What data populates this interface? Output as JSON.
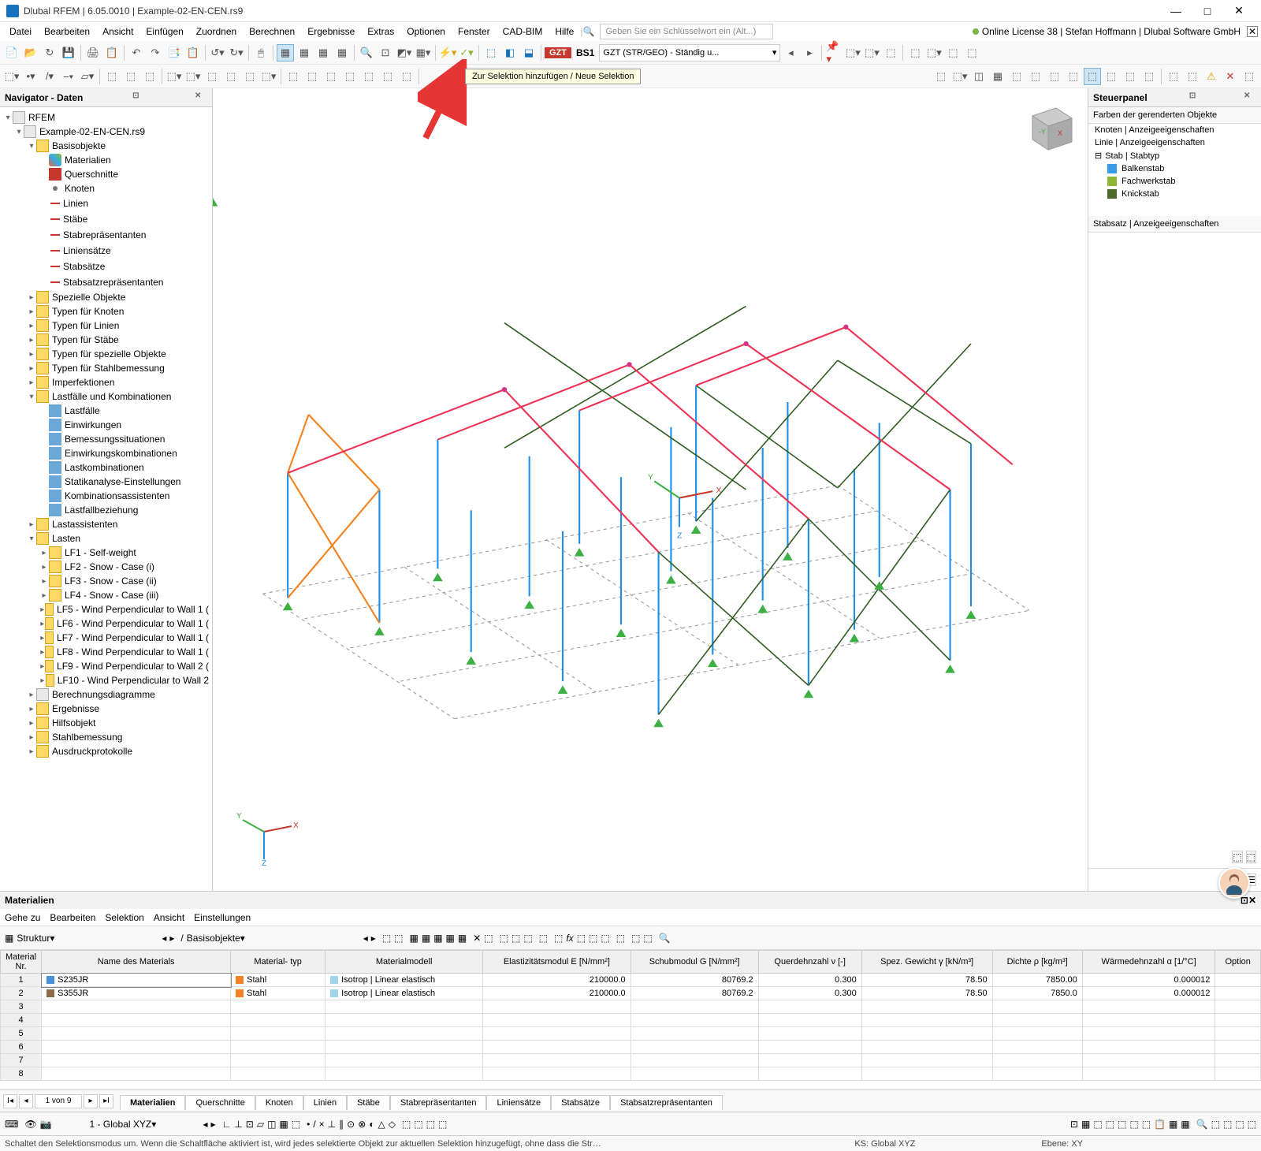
{
  "app": {
    "title": "Dlubal RFEM | 6.05.0010 | Example-02-EN-CEN.rs9"
  },
  "menu": [
    "Datei",
    "Bearbeiten",
    "Ansicht",
    "Einfügen",
    "Zuordnen",
    "Berechnen",
    "Ergebnisse",
    "Extras",
    "Optionen",
    "Fenster",
    "CAD-BIM",
    "Hilfe"
  ],
  "menu_search_placeholder": "Geben Sie ein Schlüsselwort ein (Alt...)",
  "license_text": "Online License 38 | Stefan Hoffmann | Dlubal Software GmbH",
  "toolbar1": {
    "badge": "GZT",
    "bs": "BS1",
    "combo": "GZT (STR/GEO) - Ständig u..."
  },
  "tooltip": "Zur Selektion hinzufügen / Neue Selektion",
  "navigator": {
    "title": "Navigator - Daten",
    "root": "RFEM",
    "file": "Example-02-EN-CEN.rs9",
    "basis": "Basisobjekte",
    "basis_children": [
      "Materialien",
      "Querschnitte",
      "Knoten",
      "Linien",
      "Stäbe",
      "Stabrepräsentanten",
      "Liniensätze",
      "Stabsätze",
      "Stabsatzrepräsentanten"
    ],
    "folders1": [
      "Spezielle Objekte",
      "Typen für Knoten",
      "Typen für Linien",
      "Typen für Stäbe",
      "Typen für spezielle Objekte",
      "Typen für Stahlbemessung",
      "Imperfektionen"
    ],
    "lastfalle": "Lastfälle und Kombinationen",
    "lastfalle_children": [
      "Lastfälle",
      "Einwirkungen",
      "Bemessungssituationen",
      "Einwirkungskombinationen",
      "Lastkombinationen",
      "Statikanalyse-Einstellungen",
      "Kombinationsassistenten",
      "Lastfallbeziehung"
    ],
    "lastass": "Lastassistenten",
    "lasten": "Lasten",
    "loads": [
      "LF1 - Self-weight",
      "LF2 - Snow - Case (i)",
      "LF3 - Snow - Case (ii)",
      "LF4 - Snow - Case (iii)",
      "LF5 - Wind Perpendicular to Wall 1 (",
      "LF6 - Wind Perpendicular to Wall 1 (",
      "LF7 - Wind Perpendicular to Wall 1 (",
      "LF8 - Wind Perpendicular to Wall 1 (",
      "LF9 - Wind Perpendicular to Wall 2 (",
      "LF10 - Wind Perpendicular to Wall 2"
    ],
    "folders2": [
      "Berechnungsdiagramme",
      "Ergebnisse",
      "Hilfsobjekt",
      "Stahlbemessung",
      "Ausdruckprotokolle"
    ]
  },
  "steuer": {
    "title": "Steuerpanel",
    "sec1": "Farben der gerenderten Objekte",
    "rows1": [
      "Knoten | Anzeigeeigenschaften",
      "Linie | Anzeigeeigenschaften"
    ],
    "stab_head": "Stab | Stabtyp",
    "stabs": [
      {
        "label": "Balkenstab",
        "color": "#3a9be8"
      },
      {
        "label": "Fachwerkstab",
        "color": "#8fb536"
      },
      {
        "label": "Knickstab",
        "color": "#4d6b2c"
      }
    ],
    "sec2": "Stabsatz | Anzeigeeigenschaften"
  },
  "table": {
    "title": "Materialien",
    "menus": [
      "Gehe zu",
      "Bearbeiten",
      "Selektion",
      "Ansicht",
      "Einstellungen"
    ],
    "combo1": "Struktur",
    "combo2": "Basisobjekte",
    "headers": [
      "Material\nNr.",
      "Name des Materials",
      "Material-\ntyp",
      "Materialmodell",
      "Elastizitätsmodul\nE [N/mm²]",
      "Schubmodul\nG [N/mm²]",
      "Querdehnzahl\nν [-]",
      "Spez. Gewicht\nγ [kN/m³]",
      "Dichte\nρ [kg/m³]",
      "Wärmedehnzahl\nα [1/°C]",
      "Option"
    ],
    "rows": [
      {
        "nr": "1",
        "name": "S235JR",
        "typ": "Stahl",
        "model": "Isotrop | Linear elastisch",
        "e": "210000.0",
        "g": "80769.2",
        "v": "0.300",
        "gw": "78.50",
        "rho": "7850.00",
        "alpha": "0.000012"
      },
      {
        "nr": "2",
        "name": "S355JR",
        "typ": "Stahl",
        "model": "Isotrop | Linear elastisch",
        "e": "210000.0",
        "g": "80769.2",
        "v": "0.300",
        "gw": "78.50",
        "rho": "7850.0",
        "alpha": "0.000012"
      }
    ],
    "empty_rows": [
      "3",
      "4",
      "5",
      "6",
      "7",
      "8"
    ],
    "pager": "1 von 9",
    "tabs": [
      "Materialien",
      "Querschnitte",
      "Knoten",
      "Linien",
      "Stäbe",
      "Stabrepräsentanten",
      "Liniensätze",
      "Stabsätze",
      "Stabsatzrepräsentanten"
    ]
  },
  "status": {
    "ks_combo": "1 - Global XYZ",
    "hint": "Schaltet den Selektionsmodus um. Wenn die Schaltfläche aktiviert ist, wird jedes selektierte Objekt zur aktuellen Selektion hinzugefügt, ohne dass die Strg-Taste gedrückt wird.",
    "ks": "KS: Global XYZ",
    "ebene": "Ebene: XY"
  }
}
